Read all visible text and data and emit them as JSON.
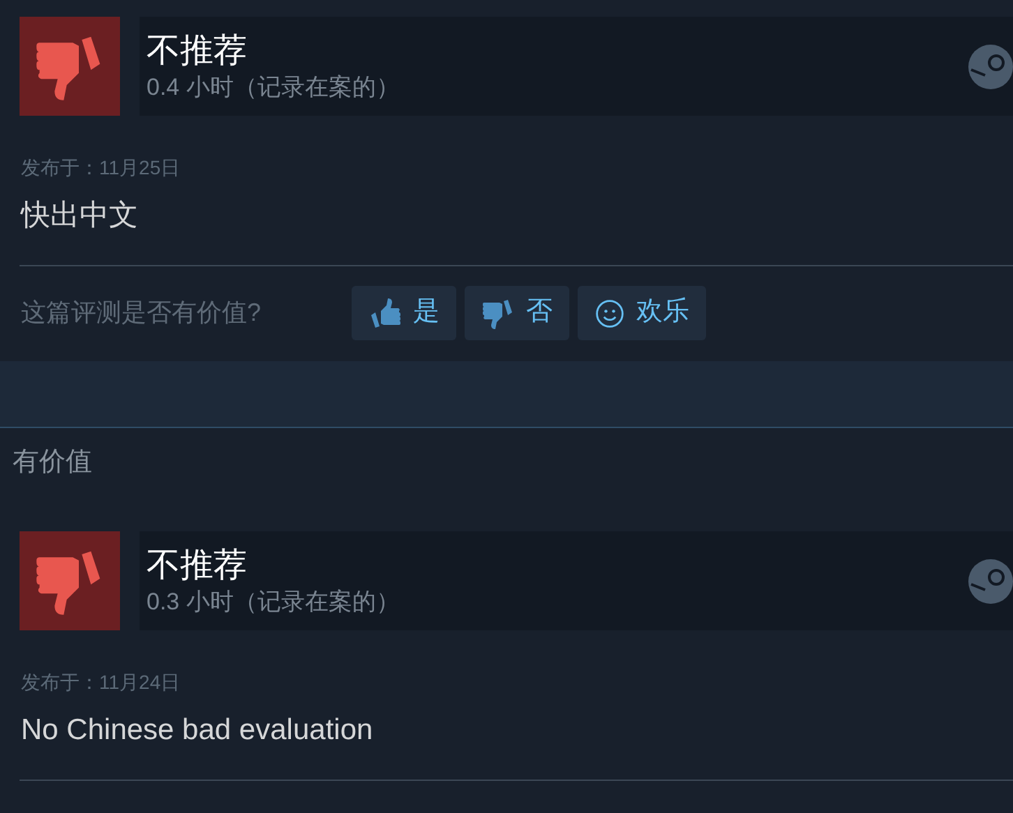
{
  "reviews": [
    {
      "recommended": false,
      "verdict": "不推荐",
      "hours": "0.4 小时（记录在案的）",
      "date": "发布于：11月25日",
      "text": "快出中文",
      "helpful": {
        "question": "这篇评测是否有价值?",
        "buttons": [
          {
            "kind": "yes",
            "label": "是"
          },
          {
            "kind": "no",
            "label": "否"
          },
          {
            "kind": "funny",
            "label": "欢乐"
          }
        ]
      }
    },
    {
      "recommended": false,
      "verdict": "不推荐",
      "hours": "0.3 小时（记录在案的）",
      "date": "发布于：11月24日",
      "text": "No Chinese bad evaluation"
    }
  ],
  "section_heading": "有价值"
}
